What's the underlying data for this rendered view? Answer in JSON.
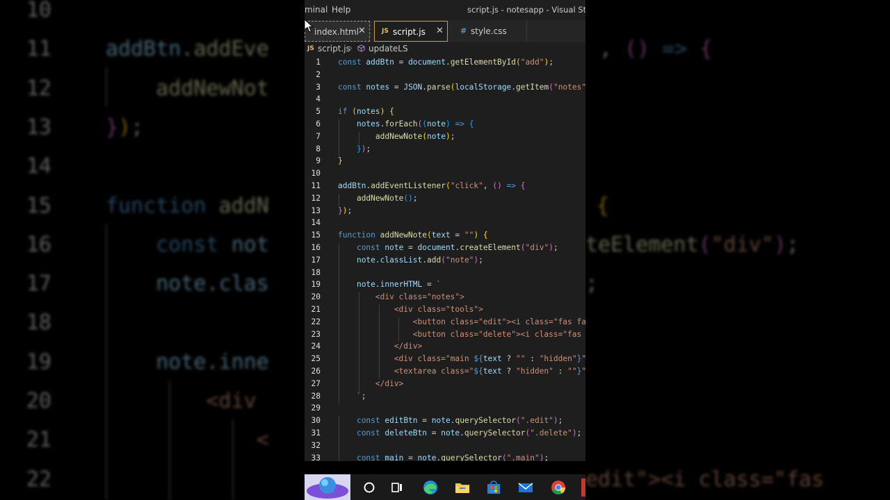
{
  "window": {
    "menu_terminal": "minal",
    "menu_help": "Help",
    "title": "script.js - notesapp - Visual Studio"
  },
  "tabs": [
    {
      "icon": "",
      "label": "index.html"
    },
    {
      "icon": "JS",
      "label": "script.js"
    },
    {
      "icon": "#",
      "label": "style.css"
    }
  ],
  "breadcrumb": {
    "file_icon": "JS",
    "file": "script.js",
    "symbol": "updateLS"
  },
  "code": [
    {
      "n": "1",
      "s": [
        [
          "kw",
          "const "
        ],
        [
          "vr",
          "addBtn"
        ],
        [
          "tx",
          " = "
        ],
        [
          "vr",
          "document"
        ],
        [
          "tx",
          "."
        ],
        [
          "fn",
          "getElementById"
        ],
        [
          "b1",
          "("
        ],
        [
          "st",
          "\"add\""
        ],
        [
          "b1",
          ")"
        ],
        [
          "tx",
          ";"
        ]
      ]
    },
    {
      "n": "2",
      "s": []
    },
    {
      "n": "3",
      "s": [
        [
          "kw",
          "const "
        ],
        [
          "vr",
          "notes"
        ],
        [
          "tx",
          " = "
        ],
        [
          "vr",
          "JSON"
        ],
        [
          "tx",
          "."
        ],
        [
          "fn",
          "parse"
        ],
        [
          "b1",
          "("
        ],
        [
          "vr",
          "localStorage"
        ],
        [
          "tx",
          "."
        ],
        [
          "fn",
          "getItem"
        ],
        [
          "b2",
          "("
        ],
        [
          "st",
          "\"notes\""
        ],
        [
          "b2",
          ")"
        ],
        [
          "b1",
          ")"
        ],
        [
          "tx",
          ";"
        ]
      ]
    },
    {
      "n": "4",
      "s": []
    },
    {
      "n": "5",
      "s": [
        [
          "kw",
          "if "
        ],
        [
          "b1",
          "("
        ],
        [
          "vr",
          "notes"
        ],
        [
          "b1",
          ") "
        ],
        [
          "b1",
          "{"
        ]
      ]
    },
    {
      "n": "6",
      "s": [
        [
          "tx",
          "    "
        ],
        [
          "vr",
          "notes"
        ],
        [
          "tx",
          "."
        ],
        [
          "fn",
          "forEach"
        ],
        [
          "b2",
          "("
        ],
        [
          "b3",
          "("
        ],
        [
          "vr",
          "note"
        ],
        [
          "b3",
          ")"
        ],
        [
          "kw",
          " => "
        ],
        [
          "b3",
          "{"
        ]
      ]
    },
    {
      "n": "7",
      "s": [
        [
          "tx",
          "        "
        ],
        [
          "fn",
          "addNewNote"
        ],
        [
          "b1",
          "("
        ],
        [
          "vr",
          "note"
        ],
        [
          "b1",
          ")"
        ],
        [
          "tx",
          ";"
        ]
      ]
    },
    {
      "n": "8",
      "s": [
        [
          "tx",
          "    "
        ],
        [
          "b3",
          "}"
        ],
        [
          "b2",
          ")"
        ],
        [
          "tx",
          ";"
        ]
      ]
    },
    {
      "n": "9",
      "s": [
        [
          "b1",
          "}"
        ]
      ]
    },
    {
      "n": "10",
      "s": []
    },
    {
      "n": "11",
      "s": [
        [
          "vr",
          "addBtn"
        ],
        [
          "tx",
          "."
        ],
        [
          "fn",
          "addEventListener"
        ],
        [
          "b1",
          "("
        ],
        [
          "st",
          "\"click\""
        ],
        [
          "tx",
          ", "
        ],
        [
          "b2",
          "()"
        ],
        [
          "kw",
          " => "
        ],
        [
          "b2",
          "{"
        ]
      ]
    },
    {
      "n": "12",
      "s": [
        [
          "tx",
          "    "
        ],
        [
          "fn",
          "addNewNote"
        ],
        [
          "b3",
          "()"
        ],
        [
          "tx",
          ";"
        ]
      ]
    },
    {
      "n": "13",
      "s": [
        [
          "b2",
          "}"
        ],
        [
          "b1",
          ")"
        ],
        [
          "tx",
          ";"
        ]
      ]
    },
    {
      "n": "14",
      "s": []
    },
    {
      "n": "15",
      "s": [
        [
          "kw",
          "function "
        ],
        [
          "fn",
          "addNewNote"
        ],
        [
          "b1",
          "("
        ],
        [
          "vr",
          "text"
        ],
        [
          "tx",
          " = "
        ],
        [
          "st",
          "\"\""
        ],
        [
          "b1",
          ") "
        ],
        [
          "b1",
          "{"
        ]
      ]
    },
    {
      "n": "16",
      "s": [
        [
          "tx",
          "    "
        ],
        [
          "kw",
          "const "
        ],
        [
          "vr",
          "note"
        ],
        [
          "tx",
          " = "
        ],
        [
          "vr",
          "document"
        ],
        [
          "tx",
          "."
        ],
        [
          "fn",
          "createElement"
        ],
        [
          "b2",
          "("
        ],
        [
          "st",
          "\"div\""
        ],
        [
          "b2",
          ")"
        ],
        [
          "tx",
          ";"
        ]
      ]
    },
    {
      "n": "17",
      "s": [
        [
          "tx",
          "    "
        ],
        [
          "vr",
          "note"
        ],
        [
          "tx",
          "."
        ],
        [
          "vr",
          "classList"
        ],
        [
          "tx",
          "."
        ],
        [
          "fn",
          "add"
        ],
        [
          "b2",
          "("
        ],
        [
          "st",
          "\"note\""
        ],
        [
          "b2",
          ")"
        ],
        [
          "tx",
          ";"
        ]
      ]
    },
    {
      "n": "18",
      "s": []
    },
    {
      "n": "19",
      "s": [
        [
          "tx",
          "    "
        ],
        [
          "vr",
          "note"
        ],
        [
          "tx",
          "."
        ],
        [
          "vr",
          "innerHTML"
        ],
        [
          "tx",
          " = "
        ],
        [
          "st",
          "`"
        ]
      ]
    },
    {
      "n": "20",
      "s": [
        [
          "st",
          "        <div class=\"notes\">"
        ]
      ]
    },
    {
      "n": "21",
      "s": [
        [
          "st",
          "            <div class=\"tools\">"
        ]
      ]
    },
    {
      "n": "22",
      "s": [
        [
          "st",
          "                <button class=\"edit\"><i class=\"fas fa-edit\"></i></button>"
        ]
      ]
    },
    {
      "n": "23",
      "s": [
        [
          "st",
          "                <button class=\"delete\"><i class=\"fas fa-trash-alt\"></i></button>"
        ]
      ]
    },
    {
      "n": "24",
      "s": [
        [
          "st",
          "            </div>"
        ]
      ]
    },
    {
      "n": "25",
      "s": [
        [
          "st",
          "            <div class=\"main "
        ],
        [
          "kw",
          "${"
        ],
        [
          "vr",
          "text"
        ],
        [
          "tx",
          " ? "
        ],
        [
          "st",
          "\"\""
        ],
        [
          "tx",
          " : "
        ],
        [
          "st",
          "\"hidden\""
        ],
        [
          "kw",
          "}"
        ],
        [
          "st",
          "\"></div>"
        ]
      ]
    },
    {
      "n": "26",
      "s": [
        [
          "st",
          "            <textarea class=\""
        ],
        [
          "kw",
          "${"
        ],
        [
          "vr",
          "text"
        ],
        [
          "tx",
          " ? "
        ],
        [
          "st",
          "\"hidden\""
        ],
        [
          "tx",
          " : "
        ],
        [
          "st",
          "\"\""
        ],
        [
          "kw",
          "}"
        ],
        [
          "st",
          "\"></textarea>"
        ]
      ]
    },
    {
      "n": "27",
      "s": [
        [
          "st",
          "        </div>"
        ]
      ]
    },
    {
      "n": "28",
      "s": [
        [
          "st",
          "    `"
        ],
        [
          "tx",
          ";"
        ]
      ]
    },
    {
      "n": "29",
      "s": []
    },
    {
      "n": "30",
      "s": [
        [
          "tx",
          "    "
        ],
        [
          "kw",
          "const "
        ],
        [
          "vr",
          "editBtn"
        ],
        [
          "tx",
          " = "
        ],
        [
          "vr",
          "note"
        ],
        [
          "tx",
          "."
        ],
        [
          "fn",
          "querySelector"
        ],
        [
          "b2",
          "("
        ],
        [
          "st",
          "\".edit\""
        ],
        [
          "b2",
          ")"
        ],
        [
          "tx",
          ";"
        ]
      ]
    },
    {
      "n": "31",
      "s": [
        [
          "tx",
          "    "
        ],
        [
          "kw",
          "const "
        ],
        [
          "vr",
          "deleteBtn"
        ],
        [
          "tx",
          " = "
        ],
        [
          "vr",
          "note"
        ],
        [
          "tx",
          "."
        ],
        [
          "fn",
          "querySelector"
        ],
        [
          "b2",
          "("
        ],
        [
          "st",
          "\".delete\""
        ],
        [
          "b2",
          ")"
        ],
        [
          "tx",
          ";"
        ]
      ]
    },
    {
      "n": "32",
      "s": []
    },
    {
      "n": "33",
      "s": [
        [
          "tx",
          "    "
        ],
        [
          "kw",
          "const "
        ],
        [
          "vr",
          "main"
        ],
        [
          "tx",
          " = "
        ],
        [
          "vr",
          "note"
        ],
        [
          "tx",
          "."
        ],
        [
          "fn",
          "querySelector"
        ],
        [
          "b2",
          "("
        ],
        [
          "st",
          "\".main\""
        ],
        [
          "b2",
          ")"
        ],
        [
          "tx",
          ";"
        ]
      ]
    }
  ],
  "background": {
    "lines": [
      {
        "n": "10",
        "s": []
      },
      {
        "n": "11",
        "s": [
          [
            "vr",
            "addBtn"
          ],
          [
            "tx",
            "."
          ],
          [
            "fn",
            "addEve"
          ]
        ]
      },
      {
        "n": "12",
        "s": [
          [
            "tx",
            "    "
          ],
          [
            "fn",
            "addNewNot"
          ]
        ]
      },
      {
        "n": "13",
        "s": [
          [
            "b2",
            "}"
          ],
          [
            "b1",
            ")"
          ],
          [
            "tx",
            ";"
          ]
        ]
      },
      {
        "n": "14",
        "s": []
      },
      {
        "n": "15",
        "s": [
          [
            "kw",
            "function "
          ],
          [
            "fn",
            "addN"
          ]
        ]
      },
      {
        "n": "16",
        "s": [
          [
            "tx",
            "    "
          ],
          [
            "kw",
            "const "
          ],
          [
            "vr",
            "not"
          ]
        ]
      },
      {
        "n": "17",
        "s": [
          [
            "tx",
            "    "
          ],
          [
            "vr",
            "note"
          ],
          [
            "tx",
            "."
          ],
          [
            "vr",
            "clas"
          ]
        ]
      },
      {
        "n": "18",
        "s": []
      },
      {
        "n": "19",
        "s": [
          [
            "tx",
            "    "
          ],
          [
            "vr",
            "note"
          ],
          [
            "tx",
            "."
          ],
          [
            "vr",
            "inne"
          ]
        ]
      },
      {
        "n": "20",
        "s": [
          [
            "st",
            "        <div"
          ]
        ]
      },
      {
        "n": "21",
        "s": [
          [
            "st",
            "            <"
          ]
        ]
      },
      {
        "n": "22",
        "s": []
      }
    ],
    "right_fragments": [
      {
        "n": "11",
        "s": [
          [
            "tx",
            ", "
          ],
          [
            "b2",
            "()"
          ],
          [
            "kw",
            " => "
          ],
          [
            "b2",
            "{"
          ]
        ]
      },
      {
        "n": "15",
        "s": [
          [
            "b1",
            "{"
          ]
        ]
      },
      {
        "n": "16",
        "s": [
          [
            "fn",
            "teElement"
          ],
          [
            "b2",
            "("
          ],
          [
            "st",
            "\"div\""
          ],
          [
            "b2",
            ")"
          ],
          [
            "tx",
            ";"
          ]
        ]
      },
      {
        "n": "17",
        "s": [
          [
            "tx",
            ";"
          ]
        ]
      },
      {
        "n": "22",
        "s": [
          [
            "st",
            "edit\"><i class=\"fas"
          ]
        ]
      }
    ]
  },
  "taskbar": {
    "items": [
      "widgets-icon",
      "cortana-circle-icon",
      "task-view-icon",
      "edge-icon",
      "file-explorer-icon",
      "store-icon",
      "mail-icon",
      "chrome-icon"
    ]
  }
}
